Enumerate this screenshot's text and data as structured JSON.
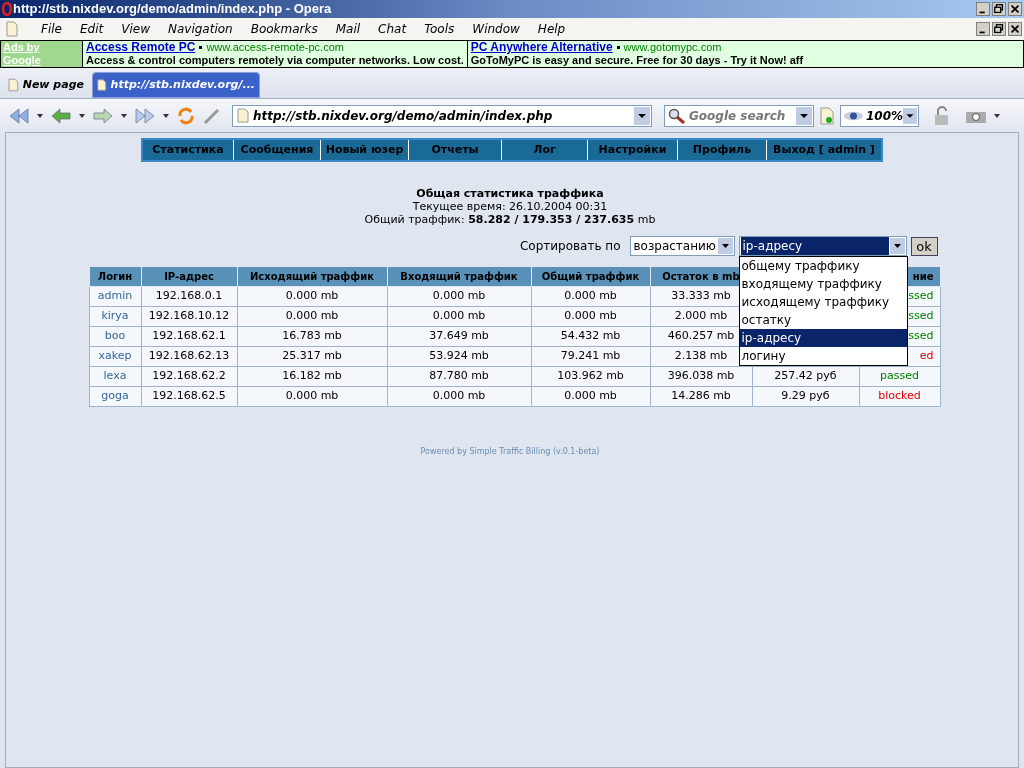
{
  "window": {
    "title": "http://stb.nixdev.org/demo/admin/index.php - Opera"
  },
  "menu": [
    "File",
    "Edit",
    "View",
    "Navigation",
    "Bookmarks",
    "Mail",
    "Chat",
    "Tools",
    "Window",
    "Help"
  ],
  "ads": {
    "label": "Ads by Google",
    "items": [
      {
        "title": "Access Remote PC",
        "url": "www.access-remote-pc.com",
        "text": "Access & control computers remotely via computer networks. Low cost."
      },
      {
        "title": "PC Anywhere Alternative",
        "url": "www.gotomypc.com",
        "text": "GoToMyPC is easy and secure. Free for 30 days - Try it Now! aff"
      }
    ]
  },
  "tabs": [
    {
      "label": "New page",
      "selected": false
    },
    {
      "label": "http://stb.nixdev.org/...",
      "selected": true
    }
  ],
  "toolbar": {
    "address": "http://stb.nixdev.org/demo/admin/index.php",
    "search_placeholder": "Google search",
    "zoom": "100%"
  },
  "nav": [
    "Статистика",
    "Сообщения",
    "Новый юзер",
    "Отчеты",
    "Лог",
    "Настройки",
    "Профиль",
    "Выход [ admin ]"
  ],
  "heading": "Общая статистика траффика",
  "time_line": "Текущее время: 26.10.2004 00:31",
  "total_line": "Общий траффик: **58.282 / 179.353 / 237.635** mb",
  "sort": {
    "label": "Сортировать по",
    "order": "возрастанию",
    "field": "ip-адресу",
    "button": "ok",
    "options": [
      {
        "label": "общему траффику",
        "selected": false
      },
      {
        "label": "входящему траффику",
        "selected": false
      },
      {
        "label": "исходящему траффику",
        "selected": false
      },
      {
        "label": "остатку",
        "selected": false
      },
      {
        "label": "ip-адресу",
        "selected": true
      },
      {
        "label": "логину",
        "selected": false
      }
    ]
  },
  "table": {
    "columns": [
      {
        "label": "Логин"
      },
      {
        "label": "IP-адрес"
      },
      {
        "label": "Исходящий траффик"
      },
      {
        "label": "Входящий траффик"
      },
      {
        "label": "Общий траффик"
      },
      {
        "label": "Остаток в mb"
      },
      {},
      {
        "label": "ние",
        "cut": true
      }
    ],
    "rows": [
      {
        "login": "admin",
        "ip": "192.168.0.1",
        "out": "0.000 mb",
        "in": "0.000 mb",
        "total": "0.000 mb",
        "rest": "33.333 mb",
        "status": {
          "text": "ssed",
          "kind": "passed",
          "cut": true
        }
      },
      {
        "login": "kirya",
        "ip": "192.168.10.12",
        "out": "0.000 mb",
        "in": "0.000 mb",
        "total": "0.000 mb",
        "rest": "2.000 mb",
        "status": {
          "text": "ssed",
          "kind": "passed",
          "cut": true
        }
      },
      {
        "login": "boo",
        "ip": "192.168.62.1",
        "out": "16.783 mb",
        "in": "37.649 mb",
        "total": "54.432 mb",
        "rest": "460.257 mb",
        "status": {
          "text": "ssed",
          "kind": "passed",
          "cut": true
        }
      },
      {
        "login": "xakep",
        "ip": "192.168.62.13",
        "out": "25.317 mb",
        "in": "53.924 mb",
        "total": "79.241 mb",
        "rest": "2.138 mb",
        "status": {
          "text": "ed",
          "kind": "blocked",
          "cut": true
        }
      },
      {
        "login": "lexa",
        "ip": "192.168.62.2",
        "out": "16.182 mb",
        "in": "87.780 mb",
        "total": "103.962 mb",
        "rest": "396.038 mb",
        "rub": "257.42 руб",
        "status": {
          "text": "passed",
          "kind": "passed",
          "cut": false
        }
      },
      {
        "login": "goga",
        "ip": "192.168.62.5",
        "out": "0.000 mb",
        "in": "0.000 mb",
        "total": "0.000 mb",
        "rest": "14.286 mb",
        "rub": "9.29 руб",
        "status": {
          "text": "blocked",
          "kind": "blocked",
          "cut": false
        }
      }
    ]
  },
  "footer": "Powered by Simple Traffic Billing (v.0.1-beta)"
}
